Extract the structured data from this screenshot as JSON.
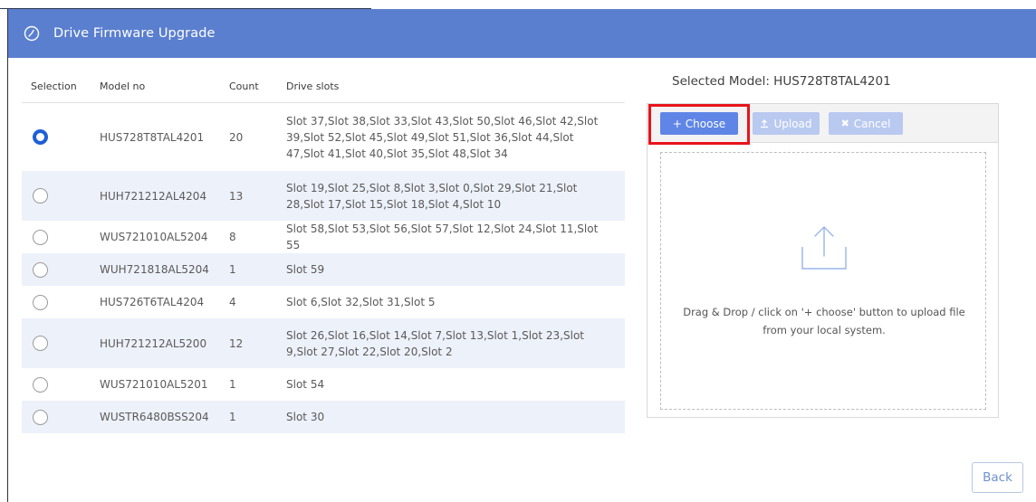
{
  "dialog": {
    "title": "Drive Firmware Upgrade",
    "title_icon": "firmware-icon"
  },
  "table": {
    "headers": [
      "Selection",
      "Model no",
      "Count",
      "Drive slots"
    ],
    "rows": [
      {
        "selected": true,
        "model": "HUS728T8TAL4201",
        "count": "20",
        "slots": "Slot 37,Slot 38,Slot 33,Slot 43,Slot 50,Slot 46,Slot 42,Slot 39,Slot 52,Slot 45,Slot 49,Slot 51,Slot 36,Slot 44,Slot 47,Slot 41,Slot 40,Slot 35,Slot 48,Slot 34"
      },
      {
        "selected": false,
        "model": "HUH721212AL4204",
        "count": "13",
        "slots": "Slot 19,Slot 25,Slot 8,Slot 3,Slot 0,Slot 29,Slot 21,Slot 28,Slot 17,Slot 15,Slot 18,Slot 4,Slot 10"
      },
      {
        "selected": false,
        "model": "WUS721010AL5204",
        "count": "8",
        "slots": "Slot 58,Slot 53,Slot 56,Slot 57,Slot 12,Slot 24,Slot 11,Slot 55"
      },
      {
        "selected": false,
        "model": "WUH721818AL5204",
        "count": "1",
        "slots": "Slot 59"
      },
      {
        "selected": false,
        "model": "HUS726T6TAL4204",
        "count": "4",
        "slots": "Slot 6,Slot 32,Slot 31,Slot 5"
      },
      {
        "selected": false,
        "model": "HUH721212AL5200",
        "count": "12",
        "slots": "Slot 26,Slot 16,Slot 14,Slot 7,Slot 13,Slot 1,Slot 23,Slot 9,Slot 27,Slot 22,Slot 20,Slot 2"
      },
      {
        "selected": false,
        "model": "WUS721010AL5201",
        "count": "1",
        "slots": "Slot 54"
      },
      {
        "selected": false,
        "model": "WUSTR6480BSS204",
        "count": "1",
        "slots": "Slot 30"
      }
    ]
  },
  "uploader": {
    "selected_model": "Selected Model: HUS728T8TAL4201",
    "choose_label": "+ Choose",
    "upload_label": "Upload",
    "cancel_label": "Cancel",
    "drop_text_line1": "Drag & Drop / click on '+ choose' button to upload file",
    "drop_text_line2": "from your local system.",
    "drop_icon": "upload-icon"
  },
  "footer": {
    "back_label": "Back"
  },
  "colors": {
    "header": "#5b7fcf",
    "accent": "#1f5fd8",
    "choose": "#5f86e6",
    "disabled": "#b9c9f0",
    "highlight": "#e8141b",
    "row_alt": "#edf1fa"
  }
}
